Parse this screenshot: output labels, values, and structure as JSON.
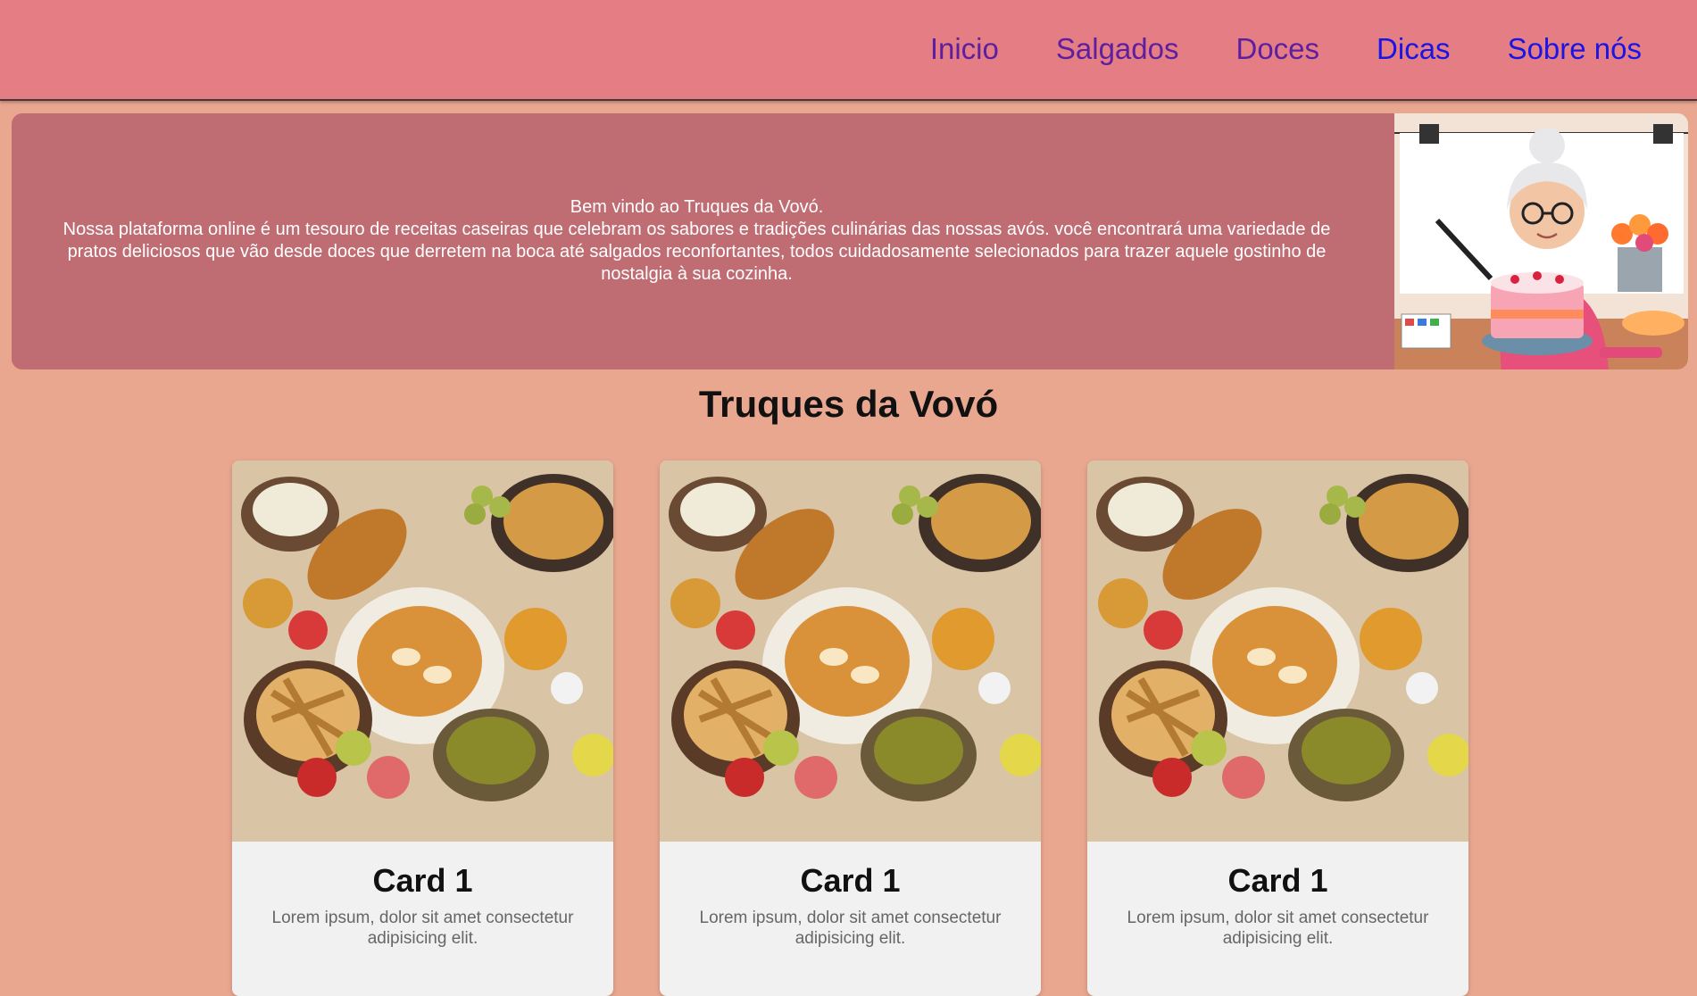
{
  "nav": {
    "items": [
      {
        "label": "Inicio",
        "state": "visited"
      },
      {
        "label": "Salgados",
        "state": "visited"
      },
      {
        "label": "Doces",
        "state": "visited"
      },
      {
        "label": "Dicas",
        "state": "link"
      },
      {
        "label": "Sobre nós",
        "state": "link"
      }
    ]
  },
  "hero": {
    "welcome": "Bem vindo ao Truques da Vovó.",
    "description": "Nossa plataforma online é um tesouro de receitas caseiras que celebram os sabores e tradições culinárias das nossas avós. você encontrará uma variedade de pratos deliciosos que vão desde doces que derretem na boca até salgados reconfortantes, todos cuidadosamente selecionados para trazer aquele gostinho de nostalgia à sua cozinha."
  },
  "site_title": "Truques da Vovó",
  "cards": [
    {
      "title": "Card 1",
      "text": "Lorem ipsum, dolor sit amet consectetur adipisicing elit."
    },
    {
      "title": "Card 1",
      "text": "Lorem ipsum, dolor sit amet consectetur adipisicing elit."
    },
    {
      "title": "Card 1",
      "text": "Lorem ipsum, dolor sit amet consectetur adipisicing elit."
    }
  ],
  "colors": {
    "topbar": "#e47e84",
    "hero": "#bf6c73",
    "page_bg": "#e9a790",
    "visited_link": "#5e1ea0",
    "link": "#1a14e6"
  }
}
